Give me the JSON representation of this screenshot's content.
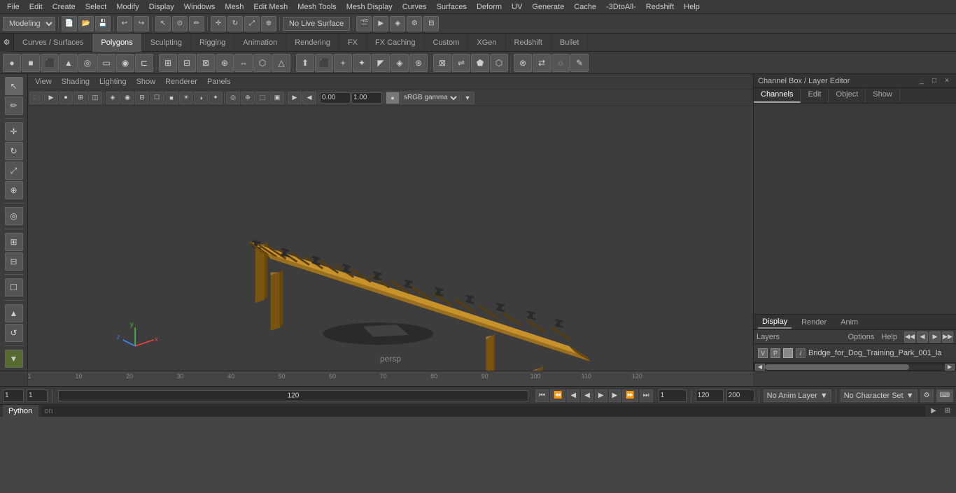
{
  "menubar": {
    "items": [
      "File",
      "Edit",
      "Create",
      "Select",
      "Modify",
      "Display",
      "Windows",
      "Mesh",
      "Edit Mesh",
      "Mesh Tools",
      "Mesh Display",
      "Curves",
      "Surfaces",
      "Deform",
      "UV",
      "Generate",
      "Cache",
      "-3DtoAll-",
      "Redshift",
      "Help"
    ]
  },
  "toolbar1": {
    "workspace": "Modeling",
    "live_surface": "No Live Surface"
  },
  "tabs": {
    "items": [
      "Curves / Surfaces",
      "Polygons",
      "Sculpting",
      "Rigging",
      "Animation",
      "Rendering",
      "FX",
      "FX Caching",
      "Custom",
      "XGen",
      "Redshift",
      "Bullet"
    ]
  },
  "active_tab": "Polygons",
  "viewport": {
    "menus": [
      "View",
      "Shading",
      "Lighting",
      "Show",
      "Renderer",
      "Panels"
    ],
    "camera_label": "persp",
    "rotate_value": "0.00",
    "scale_value": "1.00",
    "color_space": "sRGB gamma"
  },
  "channel_box": {
    "title": "Channel Box / Layer Editor",
    "tabs": [
      "Channels",
      "Edit",
      "Object",
      "Show"
    ]
  },
  "layer_editor": {
    "tabs": [
      "Display",
      "Render",
      "Anim"
    ],
    "sub_tabs": [
      "Layers",
      "Options",
      "Help"
    ],
    "layers": [
      {
        "v": "V",
        "p": "P",
        "name": "Bridge_for_Dog_Training_Park_001_la"
      }
    ]
  },
  "timeline": {
    "start": "1",
    "end": "120",
    "current": "1",
    "labels": [
      "1",
      "10",
      "20",
      "30",
      "40",
      "50",
      "60",
      "70",
      "80",
      "90",
      "100",
      "110",
      "120"
    ]
  },
  "status_bar": {
    "frame_start": "1",
    "frame_current": "1",
    "frame_range_start": "1",
    "progress_end": "120",
    "anim_end": "120",
    "anim_end2": "200",
    "no_anim_layer": "No Anim Layer",
    "no_char_set": "No Character Set"
  },
  "bottom": {
    "tab": "Python",
    "input_placeholder": "on"
  },
  "left_toolbar": {
    "icons": [
      "↖",
      "↔",
      "↕",
      "⟳",
      "⤢",
      "☐",
      "◎",
      "⊕",
      "⊞"
    ]
  }
}
